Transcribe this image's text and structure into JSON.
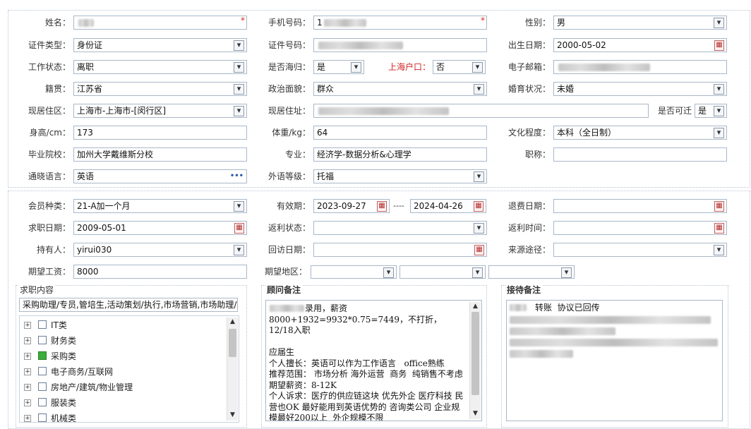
{
  "row1": {
    "name_label": "姓名：",
    "phone_label": "手机号码：",
    "phone_prefix": "1",
    "gender_label": "性别：",
    "gender_value": "男",
    "required_mark": "*"
  },
  "row2": {
    "id_type_label": "证件类型：",
    "id_type_value": "身份证",
    "id_no_label": "证件号码：",
    "birth_label": "出生日期：",
    "birth_value": "2000-05-02"
  },
  "row3": {
    "work_label": "工作状态：",
    "work_value": "离职",
    "returnee_label": "是否海归：",
    "returnee_value": "是",
    "shanghai_hukou_label": "上海户口：",
    "shanghai_hukou_value": "否",
    "email_label": "电子邮箱："
  },
  "row4": {
    "native_label": "籍贯：",
    "native_value": "江苏省",
    "political_label": "政治面貌：",
    "political_value": "群众",
    "marital_label": "婚育状况：",
    "marital_value": "未婚"
  },
  "row5": {
    "residence_label": "现居住区：",
    "residence_value": "上海市-上海市-[闵行区]",
    "address_label": "现居住址：",
    "relocate_label": "是否可迁",
    "relocate_value": "是"
  },
  "row6": {
    "height_label": "身高/cm：",
    "height_value": "173",
    "weight_label": "体重/kg：",
    "weight_value": "64",
    "education_label": "文化程度：",
    "education_value": "本科（全日制）"
  },
  "row7": {
    "school_label": "毕业院校：",
    "school_value": "加州大学戴维斯分校",
    "major_label": "专业：",
    "major_value": "经济学-数据分析&心理学",
    "title_label": "职称："
  },
  "row8": {
    "language_label": "通晓语言：",
    "language_value": "英语",
    "language_more": "•••",
    "foreign_level_label": "外语等级：",
    "foreign_level_value": "托福"
  },
  "row9": {
    "member_label": "会员种类：",
    "member_value": "21-A加一个月",
    "valid_label": "有效期：",
    "valid_start": "2023-09-27",
    "valid_sep": "----",
    "valid_end": "2024-04-26",
    "refund_date_label": "退费日期："
  },
  "row10": {
    "job_date_label": "求职日期：",
    "job_date_value": "2009-05-01",
    "rebate_status_label": "返利状态：",
    "rebate_time_label": "返利时间："
  },
  "row11": {
    "holder_label": "持有人：",
    "holder_value": "yirui030",
    "visit_date_label": "回访日期：",
    "source_label": "来源途径："
  },
  "row12": {
    "salary_label": "期望工资：",
    "salary_value": "8000",
    "region_label": "期望地区："
  },
  "job_content": {
    "title": "求职内容",
    "summary": "采购助理/专员,管培生,活动策划/执行,市场营销,市场助理/专员",
    "items": [
      {
        "label": "IT类",
        "checked": false
      },
      {
        "label": "财务类",
        "checked": false
      },
      {
        "label": "采购类",
        "checked": true
      },
      {
        "label": "电子商务/互联网",
        "checked": false
      },
      {
        "label": "房地产/建筑/物业管理",
        "checked": false
      },
      {
        "label": "服装类",
        "checked": false
      },
      {
        "label": "机械类",
        "checked": false
      }
    ],
    "expand_glyph": "+"
  },
  "advisor_note": {
    "title": "顾问备注",
    "text": "录用，薪资8000+1932=9932*0.75=7449，不打折， 12/18入职\n\n应届生\n个人擅长：英语可以作为工作语言   office熟练\n推荐范围： 市场分析 海外运营  商务  纯销售不考虑\n期望薪资：8-12K\n个人诉求：医疗的供应链这块 优先外企 医疗科技 民营也OK 最好能用到英语优势的 咨询类公司 企业规模最好200以上  外企规模不限"
  },
  "reception_note": {
    "title": "接待备注",
    "text": "转账  协议已回传"
  },
  "scroll": {
    "up": "▲",
    "down": "▼"
  }
}
